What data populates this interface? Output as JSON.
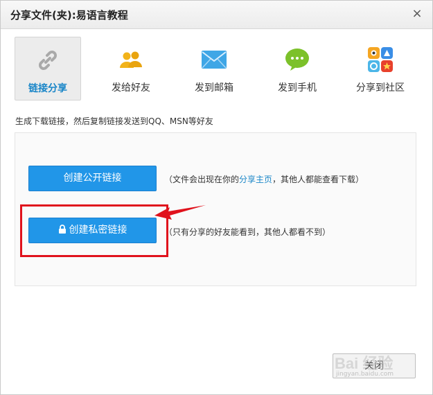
{
  "dialog": {
    "title": "分享文件(夹):易语言教程",
    "close_icon": "×"
  },
  "tabs": [
    {
      "label": "链接分享",
      "icon": "link-icon",
      "active": true
    },
    {
      "label": "发给好友",
      "icon": "friends-icon",
      "active": false
    },
    {
      "label": "发到邮箱",
      "icon": "mail-icon",
      "active": false
    },
    {
      "label": "发到手机",
      "icon": "phone-chat-icon",
      "active": false
    },
    {
      "label": "分享到社区",
      "icon": "community-icon",
      "active": false
    }
  ],
  "hint": "生成下载链接，然后复制链接发送到QQ、MSN等好友",
  "public_link": {
    "button_label": "创建公开链接",
    "note_before": "（文件会出现在你的",
    "note_link": "分享主页",
    "note_after": "，其他人都能查看下载）"
  },
  "private_link": {
    "button_label": "创建私密链接",
    "icon": "lock-icon",
    "note": "（只有分享的好友能看到，其他人都看不到）"
  },
  "footer": {
    "close_label": "关闭"
  },
  "watermark": {
    "text": "Bai 经验",
    "sub": "jingyan.baidu.com"
  },
  "colors": {
    "accent": "#2196e8",
    "highlight": "#e0121c",
    "link": "#1a86c8"
  }
}
